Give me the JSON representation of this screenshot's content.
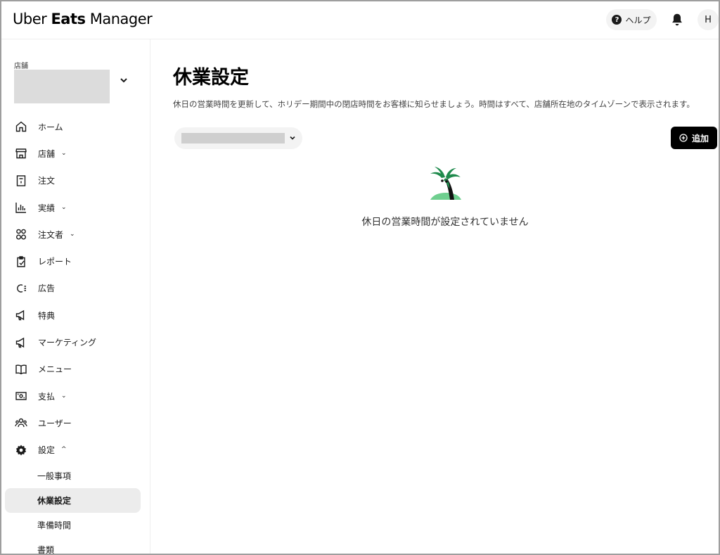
{
  "header": {
    "brand_light": "Uber",
    "brand_bold": "Eats",
    "brand_rest": "Manager",
    "help_label": "ヘルプ",
    "avatar_initial": "H"
  },
  "sidebar": {
    "store_label": "店舗",
    "items": [
      {
        "label": "ホーム",
        "icon": "home-icon",
        "caret": ""
      },
      {
        "label": "店舗",
        "icon": "store-icon",
        "caret": "⌄"
      },
      {
        "label": "注文",
        "icon": "receipt-icon",
        "caret": ""
      },
      {
        "label": "実績",
        "icon": "bar-chart-icon",
        "caret": "⌄"
      },
      {
        "label": "注文者",
        "icon": "people-icon",
        "caret": "⌄"
      },
      {
        "label": "レポート",
        "icon": "clipboard-icon",
        "caret": ""
      },
      {
        "label": "広告",
        "icon": "ads-icon",
        "caret": ""
      },
      {
        "label": "特典",
        "icon": "megaphone-icon",
        "caret": ""
      },
      {
        "label": "マーケティング",
        "icon": "marketing-megaphone-icon",
        "caret": ""
      },
      {
        "label": "メニュー",
        "icon": "book-icon",
        "caret": ""
      },
      {
        "label": "支払",
        "icon": "payment-icon",
        "caret": "⌄"
      },
      {
        "label": "ユーザー",
        "icon": "users-icon",
        "caret": ""
      },
      {
        "label": "設定",
        "icon": "gear-icon",
        "caret": "^"
      }
    ],
    "sub_items": [
      "一般事項",
      "休業設定",
      "準備時間",
      "書類"
    ],
    "active_sub": "休業設定"
  },
  "main": {
    "title": "休業設定",
    "description": "休日の営業時間を更新して、ホリデー期間中の閉店時間をお客様に知らせましょう。時間はすべて、店舗所在地のタイムゾーンで表示されます。",
    "add_label": "追加",
    "empty_message": "休日の営業時間が設定されていません"
  },
  "colors": {
    "accent": "#000000",
    "palm_leaf": "#1f8a4c",
    "island": "#6fcf8f",
    "active_bg": "#ececec"
  }
}
